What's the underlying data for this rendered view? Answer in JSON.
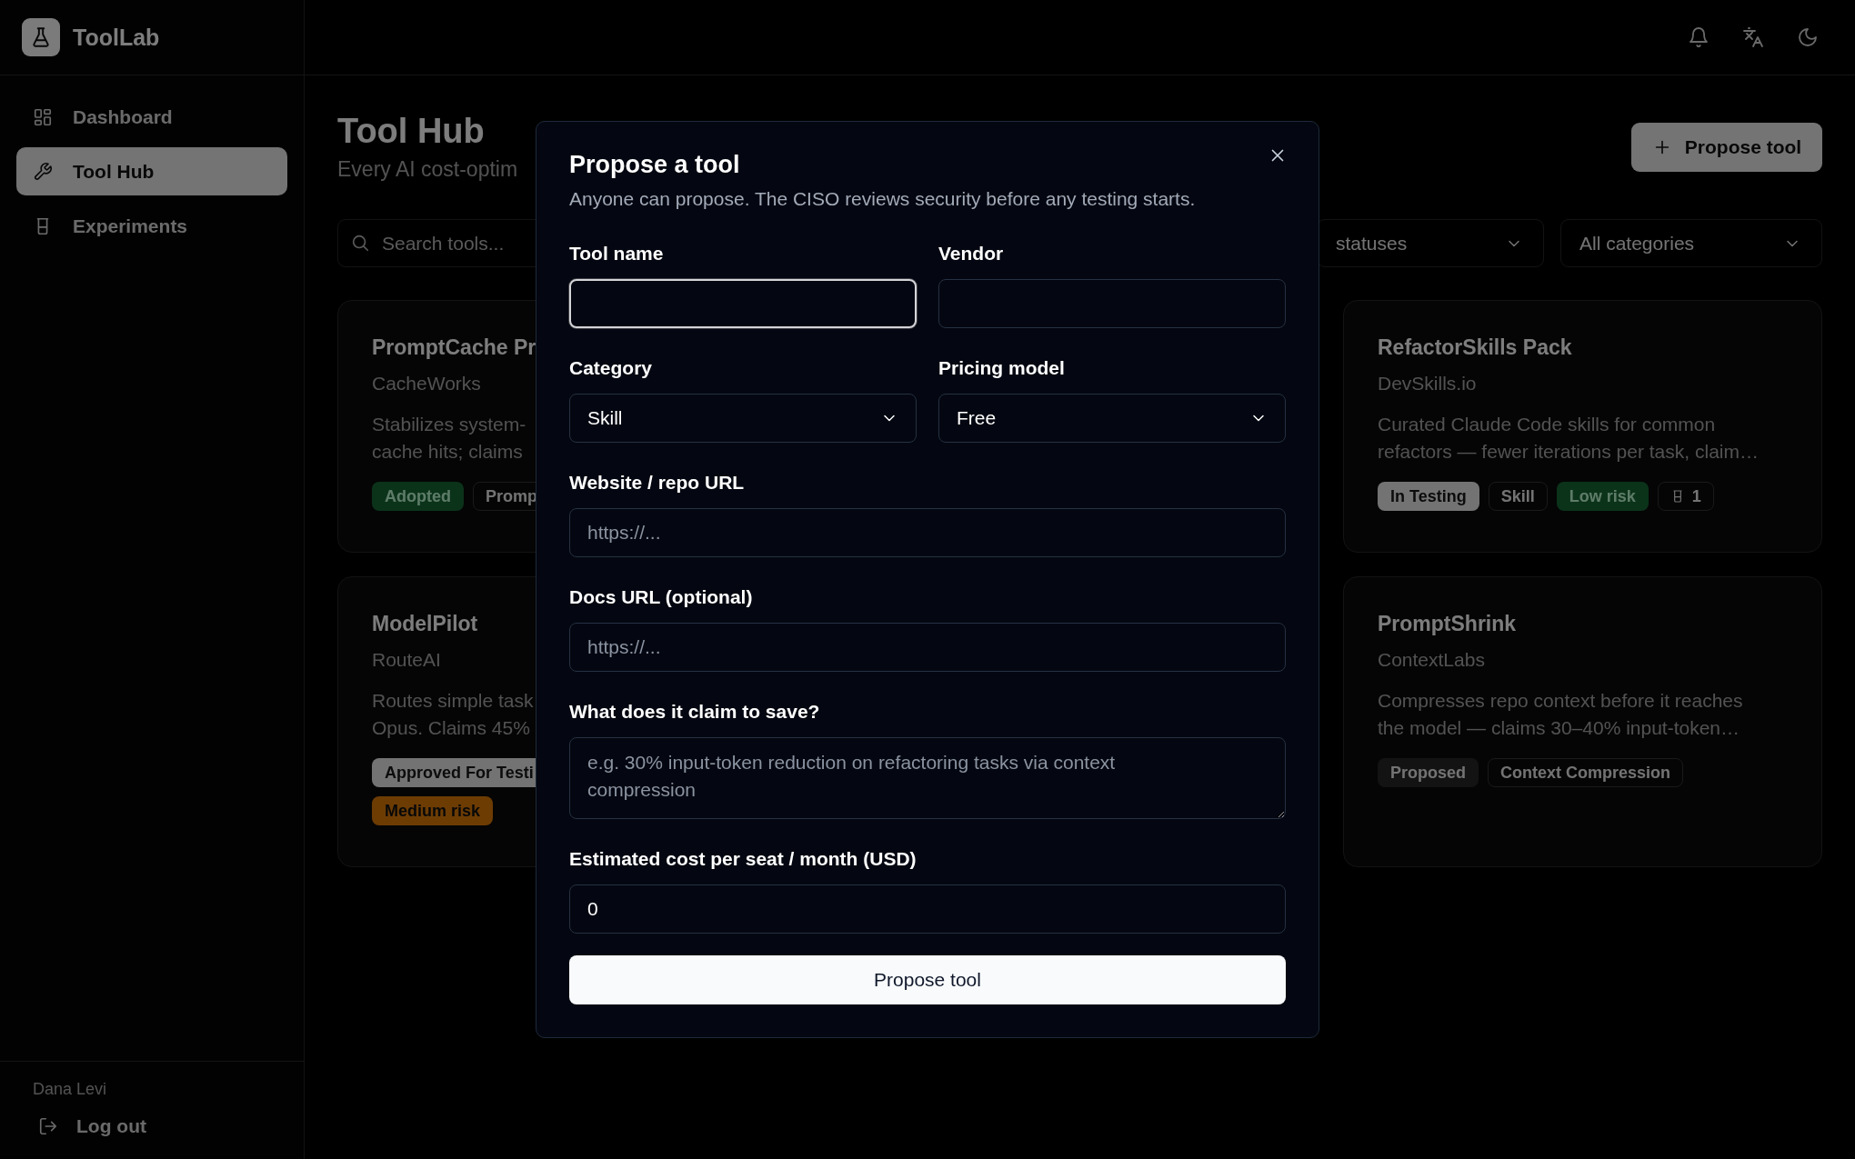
{
  "app": {
    "name": "ToolLab"
  },
  "sidebar": {
    "items": [
      {
        "label": "Dashboard",
        "selected": false
      },
      {
        "label": "Tool Hub",
        "selected": true
      },
      {
        "label": "Experiments",
        "selected": false
      }
    ],
    "user": "Dana Levi",
    "logout": "Log out"
  },
  "page": {
    "title": "Tool Hub",
    "subtitle": "Every AI cost-optim",
    "action": "Propose tool"
  },
  "filters": {
    "search_placeholder": "Search tools...",
    "status": "statuses",
    "category": "All categories"
  },
  "columns": [
    {
      "cards": [
        {
          "title": "PromptCache Pr",
          "vendor": "CacheWorks",
          "description": "Stabilizes system-\ncache hits; claims",
          "tags": [
            {
              "text": "Adopted",
              "kind": "success"
            },
            {
              "text": "Promp",
              "kind": "outline"
            }
          ]
        },
        {
          "title": "ModelPilot",
          "vendor": "RouteAI",
          "description": "Routes simple task\nOpus. Claims 45%",
          "tags": [
            {
              "text": "Approved For Testi",
              "kind": "solid"
            },
            {
              "text": "Medium risk",
              "kind": "warning"
            }
          ]
        }
      ]
    },
    {
      "cards": [
        {
          "title": "RefactorSkills Pack",
          "vendor": "DevSkills.io",
          "description": "Curated Claude Code skills for common\nrefactors — fewer iterations per task, claim…",
          "tags": [
            {
              "text": "In Testing",
              "kind": "solid"
            },
            {
              "text": "Skill",
              "kind": "outline"
            },
            {
              "text": "Low risk",
              "kind": "success"
            },
            {
              "text": "1",
              "kind": "count"
            }
          ]
        },
        {
          "title": "PromptShrink",
          "vendor": "ContextLabs",
          "description": "Compresses repo context before it reaches\nthe model — claims 30–40% input-token…",
          "tags": [
            {
              "text": "Proposed",
              "kind": "muted"
            },
            {
              "text": "Context Compression",
              "kind": "outline"
            }
          ]
        }
      ]
    }
  ],
  "modal": {
    "title": "Propose a tool",
    "description": "Anyone can propose. The CISO reviews security before any testing starts.",
    "rows": [
      {
        "fields": [
          {
            "label": "Tool name",
            "kind": "text",
            "focused": true
          },
          {
            "label": "Vendor",
            "kind": "text",
            "focused": false
          }
        ]
      },
      {
        "fields": [
          {
            "label": "Category",
            "kind": "select",
            "value": "Skill",
            "focused": false
          },
          {
            "label": "Pricing model",
            "kind": "select",
            "value": "Free",
            "focused": false
          }
        ]
      },
      {
        "fields": [
          {
            "label": "Website / repo URL",
            "kind": "text",
            "placeholder": "https://...",
            "focused": false
          }
        ]
      },
      {
        "fields": [
          {
            "label": "Docs URL (optional)",
            "kind": "text",
            "placeholder": "https://...",
            "focused": false
          }
        ]
      },
      {
        "fields": [
          {
            "label": "What does it claim to save?",
            "kind": "textarea",
            "placeholder": "e.g. 30% input-token reduction on refactoring tasks via context compression",
            "focused": false
          }
        ]
      },
      {
        "fields": [
          {
            "label": "Estimated cost per seat / month (USD)",
            "kind": "text",
            "value": "0",
            "focused": false
          }
        ]
      }
    ],
    "submit": "Propose tool"
  }
}
